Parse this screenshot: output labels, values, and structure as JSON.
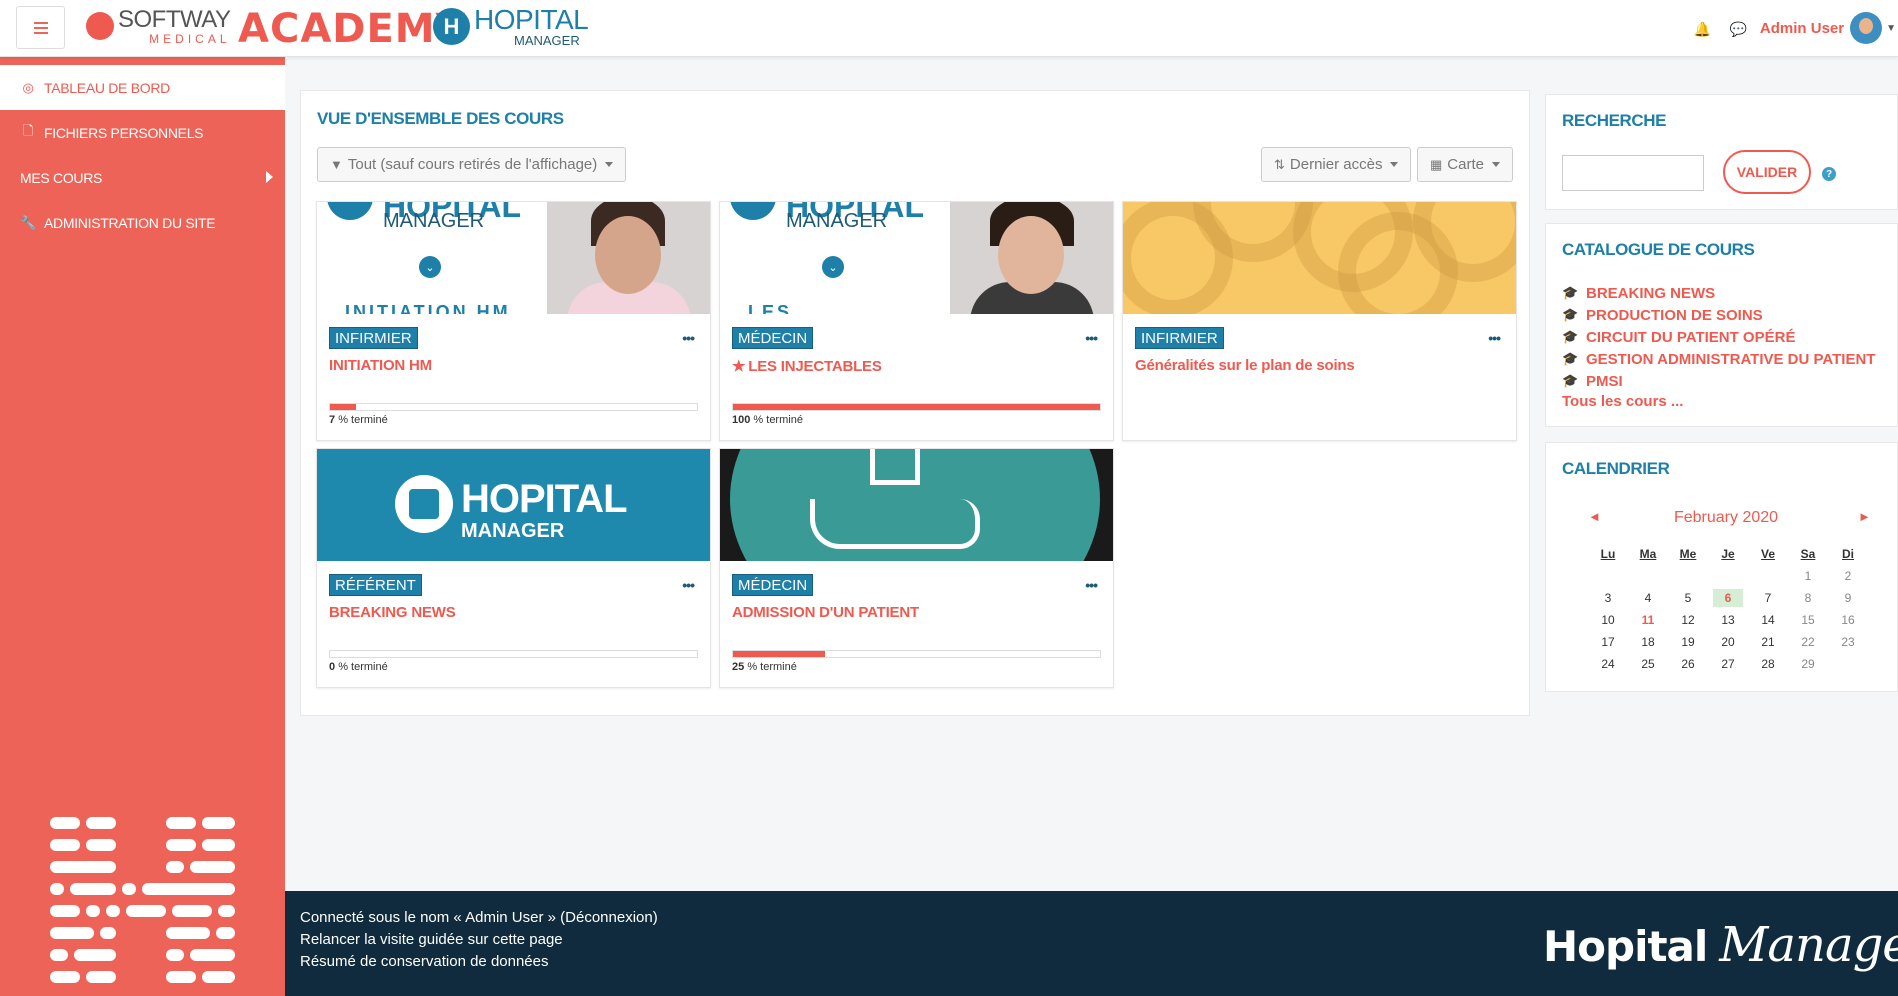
{
  "header": {
    "menu_icon": "hamburger-icon",
    "logo_softway": "SOFTWAY",
    "logo_medical": "MEDICAL",
    "logo_academy": "ACADEMY",
    "logo_hm_mark": "H",
    "logo_hopital": "HOPITAL",
    "logo_manager": "MANAGER",
    "user_name": "Admin User",
    "icons": [
      "bell-icon",
      "chat-icon",
      "chevron-down-icon"
    ]
  },
  "sidebar": {
    "items": [
      {
        "label": "TABLEAU DE BORD",
        "icon": "dashboard-icon",
        "active": true
      },
      {
        "label": "FICHIERS PERSONNELS",
        "icon": "file-icon",
        "active": false
      },
      {
        "label": "MES COURS",
        "icon": "",
        "active": false
      },
      {
        "label": "ADMINISTRATION DU SITE",
        "icon": "wrench-icon",
        "active": false
      }
    ]
  },
  "overview": {
    "title": "VUE D'ENSEMBLE DES COURS",
    "filter": "Tout (sauf cours retirés de l'affichage)",
    "sort": "Dernier accès",
    "view": "Carte",
    "courses": [
      {
        "category": "INFIRMIER",
        "title": "INITIATION HM",
        "progress": 7,
        "progress_label": "% terminé",
        "starred": false,
        "image": "hm-face",
        "image_text": "HOPITAL",
        "image_text2": "MANAGER",
        "image_cut": "INITIATION HM"
      },
      {
        "category": "MÉDECIN",
        "title": "LES INJECTABLES",
        "progress": 100,
        "progress_label": "% terminé",
        "starred": true,
        "image": "hm-face-dark",
        "image_text": "HOPITAL",
        "image_text2": "MANAGER",
        "image_cut": "LES INJECTABLES"
      },
      {
        "category": "INFIRMIER",
        "title": "Généralités sur le plan de soins",
        "progress": null,
        "progress_label": "",
        "starred": false,
        "image": "circles"
      },
      {
        "category": "RÉFÉRENT",
        "title": "BREAKING NEWS",
        "progress": 0,
        "progress_label": "% terminé",
        "starred": false,
        "image": "hm-blue",
        "image_text": "HOPITAL",
        "image_text2": "MANAGER"
      },
      {
        "category": "MÉDECIN",
        "title": "ADMISSION D'UN PATIENT",
        "progress": 25,
        "progress_label": "% terminé",
        "starred": false,
        "image": "teal-hand"
      }
    ]
  },
  "search": {
    "title": "RECHERCHE",
    "button": "VALIDER",
    "help": "?"
  },
  "catalogue": {
    "title": "CATALOGUE DE COURS",
    "items": [
      "BREAKING NEWS",
      "PRODUCTION DE SOINS",
      "CIRCUIT DU PATIENT OPÉRÉ",
      "GESTION ADMINISTRATIVE DU PATIENT",
      "PMSI"
    ],
    "all_label": "Tous les cours ..."
  },
  "calendar": {
    "title": "CALENDRIER",
    "month": "February 2020",
    "prev": "◄",
    "next": "►",
    "days": [
      "Lu",
      "Ma",
      "Me",
      "Je",
      "Ve",
      "Sa",
      "Di"
    ],
    "weeks": [
      [
        "",
        "",
        "",
        "",
        "",
        "1",
        "2"
      ],
      [
        "3",
        "4",
        "5",
        "6",
        "7",
        "8",
        "9"
      ],
      [
        "10",
        "11",
        "12",
        "13",
        "14",
        "15",
        "16"
      ],
      [
        "17",
        "18",
        "19",
        "20",
        "21",
        "22",
        "23"
      ],
      [
        "24",
        "25",
        "26",
        "27",
        "28",
        "29",
        ""
      ]
    ],
    "today": "6",
    "highlight": "11"
  },
  "footer": {
    "logged_prefix": "Connecté sous le nom « ",
    "logged_user": "Admin User",
    "logged_mid": " » (",
    "logout": "Déconnexion",
    "logged_suffix": ")",
    "tour": "Relancer la visite guidée sur cette page",
    "data": "Résumé de conservation de données",
    "brand": "Hopital",
    "brand_script": "Manager"
  },
  "colors": {
    "accent": "#ee5a4f",
    "blue": "#1e7fa8",
    "footer": "#0f2b3d"
  }
}
